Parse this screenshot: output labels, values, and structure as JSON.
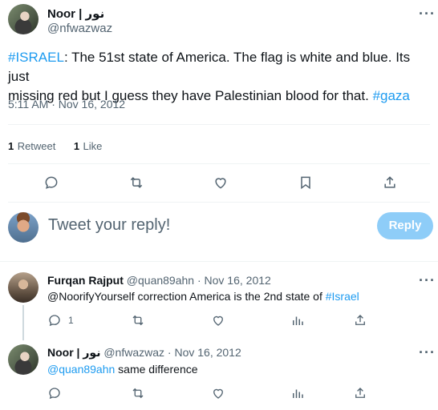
{
  "tweet": {
    "author_name": "Noor | نور",
    "author_handle": "@nfwazwaz",
    "text_hashtag": "#ISRAEL",
    "text_line1": ": The 51st state of America. The flag is white and blue. Its just",
    "text_line2": "missing red but I guess they have Palestinian blood for that.",
    "text_hashtag2": "#gaza",
    "timestamp": "5:11 AM · Nov 16, 2012",
    "retweets_count": "1",
    "retweets_label": "Retweet",
    "likes_count": "1",
    "likes_label": "Like",
    "more_label": "···"
  },
  "composer": {
    "placeholder": "Tweet your reply!",
    "reply_button": "Reply"
  },
  "replies": [
    {
      "author_name": "Furqan Rajput",
      "author_handle": "@quan89ahn",
      "date": "· Nov 16, 2012",
      "text_prefix": "@NoorifyYourself correction America is the 2nd state of ",
      "text_hashtag": "#Israel",
      "reply_count": "1",
      "more_label": "···"
    },
    {
      "author_name": "Noor | نور",
      "author_handle": "@nfwazwaz",
      "date": "· Nov 16, 2012",
      "text_mention": "@quan89ahn",
      "text_suffix": " same difference",
      "more_label": "···"
    }
  ],
  "colors": {
    "link": "#1d9bf0",
    "muted": "#536471",
    "reply_button_bg": "#8ecdf8",
    "divider": "#eff3f4"
  },
  "icons": [
    "reply-icon",
    "retweet-icon",
    "like-icon",
    "bookmark-icon",
    "share-icon",
    "views-icon",
    "more-icon"
  ]
}
